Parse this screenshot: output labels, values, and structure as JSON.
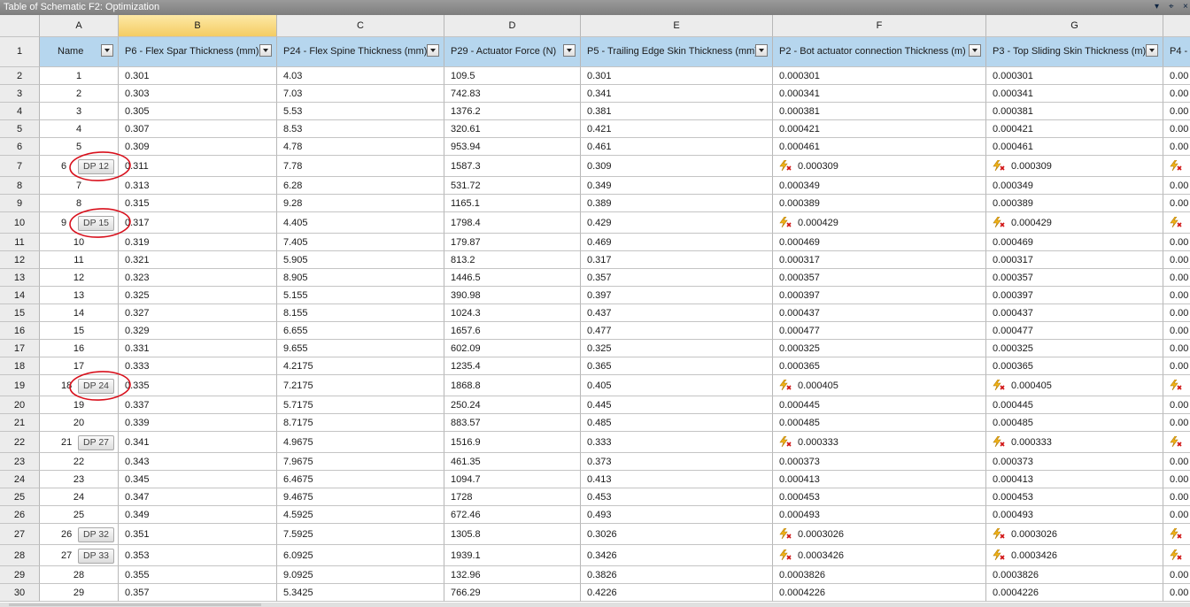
{
  "window": {
    "title": "Table of Schematic F2: Optimization",
    "controls": [
      "▾",
      "⌖",
      "×"
    ]
  },
  "columns": {
    "letters": [
      "A",
      "B",
      "C",
      "D",
      "E",
      "F",
      "G",
      ""
    ],
    "selected_letter": "B",
    "headers": [
      "Name",
      "P6 - Flex Spar Thickness (mm)",
      "P24 - Flex Spine Thickness (mm)",
      "P29 - Actuator Force (N)",
      "P5 - Trailing Edge Skin Thickness (mm)",
      "P2 - Bot actuator connection Thickness (m)",
      "P3 - Top Sliding Skin Thickness (m)",
      "P4 -"
    ]
  },
  "rows": [
    {
      "rn": "2",
      "name": "1",
      "dp": "",
      "b": "0.301",
      "c": "4.03",
      "d": "109.5",
      "e": "0.301",
      "f": "0.000301",
      "g": "0.000301",
      "h": "0.00",
      "warn": false
    },
    {
      "rn": "3",
      "name": "2",
      "dp": "",
      "b": "0.303",
      "c": "7.03",
      "d": "742.83",
      "e": "0.341",
      "f": "0.000341",
      "g": "0.000341",
      "h": "0.00",
      "warn": false
    },
    {
      "rn": "4",
      "name": "3",
      "dp": "",
      "b": "0.305",
      "c": "5.53",
      "d": "1376.2",
      "e": "0.381",
      "f": "0.000381",
      "g": "0.000381",
      "h": "0.00",
      "warn": false
    },
    {
      "rn": "5",
      "name": "4",
      "dp": "",
      "b": "0.307",
      "c": "8.53",
      "d": "320.61",
      "e": "0.421",
      "f": "0.000421",
      "g": "0.000421",
      "h": "0.00",
      "warn": false
    },
    {
      "rn": "6",
      "name": "5",
      "dp": "",
      "b": "0.309",
      "c": "4.78",
      "d": "953.94",
      "e": "0.461",
      "f": "0.000461",
      "g": "0.000461",
      "h": "0.00",
      "warn": false
    },
    {
      "rn": "7",
      "name": "6",
      "dp": "DP 12",
      "b": "0.311",
      "c": "7.78",
      "d": "1587.3",
      "e": "0.309",
      "f": "0.000309",
      "g": "0.000309",
      "h": "",
      "warn": true
    },
    {
      "rn": "8",
      "name": "7",
      "dp": "",
      "b": "0.313",
      "c": "6.28",
      "d": "531.72",
      "e": "0.349",
      "f": "0.000349",
      "g": "0.000349",
      "h": "0.00",
      "warn": false
    },
    {
      "rn": "9",
      "name": "8",
      "dp": "",
      "b": "0.315",
      "c": "9.28",
      "d": "1165.1",
      "e": "0.389",
      "f": "0.000389",
      "g": "0.000389",
      "h": "0.00",
      "warn": false
    },
    {
      "rn": "10",
      "name": "9",
      "dp": "DP 15",
      "b": "0.317",
      "c": "4.405",
      "d": "1798.4",
      "e": "0.429",
      "f": "0.000429",
      "g": "0.000429",
      "h": "",
      "warn": true
    },
    {
      "rn": "11",
      "name": "10",
      "dp": "",
      "b": "0.319",
      "c": "7.405",
      "d": "179.87",
      "e": "0.469",
      "f": "0.000469",
      "g": "0.000469",
      "h": "0.00",
      "warn": false
    },
    {
      "rn": "12",
      "name": "11",
      "dp": "",
      "b": "0.321",
      "c": "5.905",
      "d": "813.2",
      "e": "0.317",
      "f": "0.000317",
      "g": "0.000317",
      "h": "0.00",
      "warn": false
    },
    {
      "rn": "13",
      "name": "12",
      "dp": "",
      "b": "0.323",
      "c": "8.905",
      "d": "1446.5",
      "e": "0.357",
      "f": "0.000357",
      "g": "0.000357",
      "h": "0.00",
      "warn": false
    },
    {
      "rn": "14",
      "name": "13",
      "dp": "",
      "b": "0.325",
      "c": "5.155",
      "d": "390.98",
      "e": "0.397",
      "f": "0.000397",
      "g": "0.000397",
      "h": "0.00",
      "warn": false
    },
    {
      "rn": "15",
      "name": "14",
      "dp": "",
      "b": "0.327",
      "c": "8.155",
      "d": "1024.3",
      "e": "0.437",
      "f": "0.000437",
      "g": "0.000437",
      "h": "0.00",
      "warn": false
    },
    {
      "rn": "16",
      "name": "15",
      "dp": "",
      "b": "0.329",
      "c": "6.655",
      "d": "1657.6",
      "e": "0.477",
      "f": "0.000477",
      "g": "0.000477",
      "h": "0.00",
      "warn": false
    },
    {
      "rn": "17",
      "name": "16",
      "dp": "",
      "b": "0.331",
      "c": "9.655",
      "d": "602.09",
      "e": "0.325",
      "f": "0.000325",
      "g": "0.000325",
      "h": "0.00",
      "warn": false
    },
    {
      "rn": "18",
      "name": "17",
      "dp": "",
      "b": "0.333",
      "c": "4.2175",
      "d": "1235.4",
      "e": "0.365",
      "f": "0.000365",
      "g": "0.000365",
      "h": "0.00",
      "warn": false
    },
    {
      "rn": "19",
      "name": "18",
      "dp": "DP 24",
      "b": "0.335",
      "c": "7.2175",
      "d": "1868.8",
      "e": "0.405",
      "f": "0.000405",
      "g": "0.000405",
      "h": "",
      "warn": true
    },
    {
      "rn": "20",
      "name": "19",
      "dp": "",
      "b": "0.337",
      "c": "5.7175",
      "d": "250.24",
      "e": "0.445",
      "f": "0.000445",
      "g": "0.000445",
      "h": "0.00",
      "warn": false
    },
    {
      "rn": "21",
      "name": "20",
      "dp": "",
      "b": "0.339",
      "c": "8.7175",
      "d": "883.57",
      "e": "0.485",
      "f": "0.000485",
      "g": "0.000485",
      "h": "0.00",
      "warn": false
    },
    {
      "rn": "22",
      "name": "21",
      "dp": "DP 27",
      "b": "0.341",
      "c": "4.9675",
      "d": "1516.9",
      "e": "0.333",
      "f": "0.000333",
      "g": "0.000333",
      "h": "",
      "warn": true
    },
    {
      "rn": "23",
      "name": "22",
      "dp": "",
      "b": "0.343",
      "c": "7.9675",
      "d": "461.35",
      "e": "0.373",
      "f": "0.000373",
      "g": "0.000373",
      "h": "0.00",
      "warn": false
    },
    {
      "rn": "24",
      "name": "23",
      "dp": "",
      "b": "0.345",
      "c": "6.4675",
      "d": "1094.7",
      "e": "0.413",
      "f": "0.000413",
      "g": "0.000413",
      "h": "0.00",
      "warn": false
    },
    {
      "rn": "25",
      "name": "24",
      "dp": "",
      "b": "0.347",
      "c": "9.4675",
      "d": "1728",
      "e": "0.453",
      "f": "0.000453",
      "g": "0.000453",
      "h": "0.00",
      "warn": false
    },
    {
      "rn": "26",
      "name": "25",
      "dp": "",
      "b": "0.349",
      "c": "4.5925",
      "d": "672.46",
      "e": "0.493",
      "f": "0.000493",
      "g": "0.000493",
      "h": "0.00",
      "warn": false
    },
    {
      "rn": "27",
      "name": "26",
      "dp": "DP 32",
      "b": "0.351",
      "c": "7.5925",
      "d": "1305.8",
      "e": "0.3026",
      "f": "0.0003026",
      "g": "0.0003026",
      "h": "",
      "warn": true
    },
    {
      "rn": "28",
      "name": "27",
      "dp": "DP 33",
      "b": "0.353",
      "c": "6.0925",
      "d": "1939.1",
      "e": "0.3426",
      "f": "0.0003426",
      "g": "0.0003426",
      "h": "",
      "warn": true
    },
    {
      "rn": "29",
      "name": "28",
      "dp": "",
      "b": "0.355",
      "c": "9.0925",
      "d": "132.96",
      "e": "0.3826",
      "f": "0.0003826",
      "g": "0.0003826",
      "h": "0.00",
      "warn": false
    },
    {
      "rn": "30",
      "name": "29",
      "dp": "",
      "b": "0.357",
      "c": "5.3425",
      "d": "766.29",
      "e": "0.4226",
      "f": "0.0004226",
      "g": "0.0004226",
      "h": "0.00",
      "warn": false
    }
  ],
  "annotations": {
    "circled_badges": [
      "DP 12",
      "DP 15",
      "DP 24"
    ],
    "circle_color": "#d8101c"
  },
  "icons": {
    "dropdown": "filter-dropdown-icon",
    "warning": "update-required-lightning-icon"
  }
}
